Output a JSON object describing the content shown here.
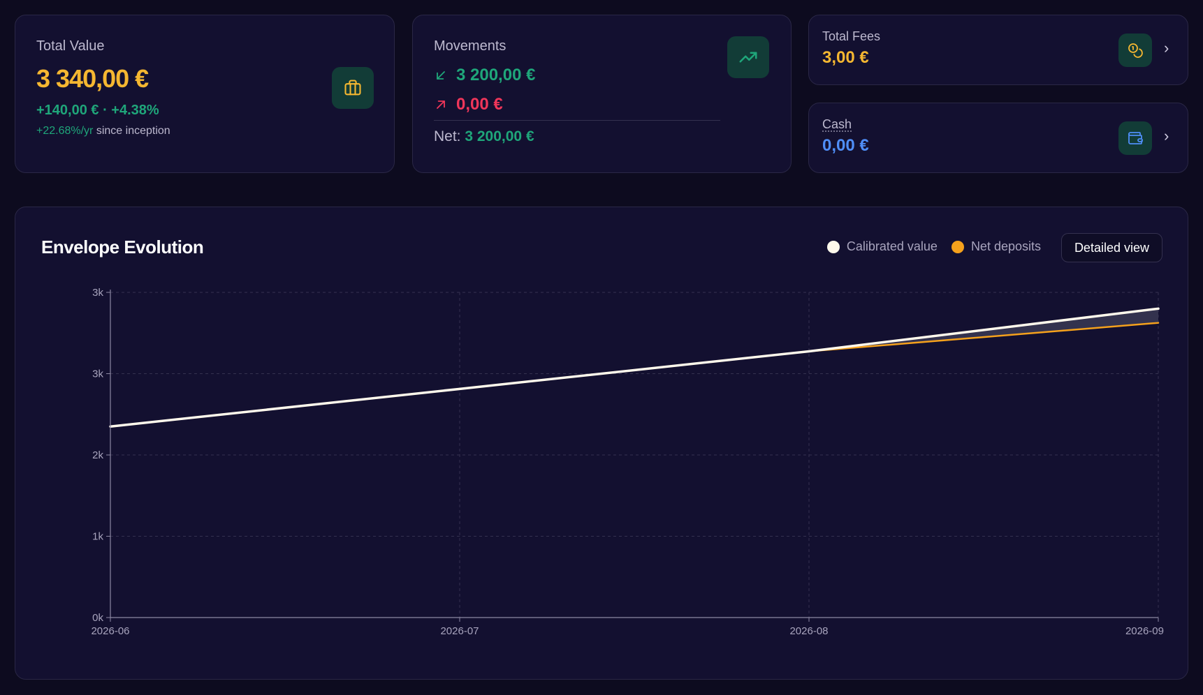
{
  "colors": {
    "gold": "#f5b731",
    "green": "#1fa67a",
    "red": "#f0365a",
    "blue": "#4f8ef7",
    "white_line": "#fff9ec",
    "orange_line": "#f5a11c"
  },
  "total_value": {
    "label": "Total Value",
    "amount": "3 340,00 €",
    "change": "+140,00 € · +4.38%",
    "annual": "+22.68%/yr",
    "since": "since inception",
    "icon": "briefcase-icon"
  },
  "movements": {
    "label": "Movements",
    "inflow": "3 200,00 €",
    "outflow": "0,00 €",
    "net_label": "Net:",
    "net_value": "3 200,00 €",
    "icon": "trending-up-icon"
  },
  "fees": {
    "label": "Total Fees",
    "amount": "3,00 €",
    "icon": "coins-icon"
  },
  "cash": {
    "label": "Cash",
    "amount": "0,00 €",
    "icon": "wallet-icon"
  },
  "chart_section": {
    "title": "Envelope Evolution",
    "detailed_button": "Detailed view"
  },
  "chart_data": {
    "type": "line",
    "title": "Envelope Evolution",
    "x": [
      "2026-06",
      "2026-07",
      "2026-08",
      "2026-09"
    ],
    "y_ticks": [
      "0k",
      "1k",
      "2k",
      "3k",
      "3k"
    ],
    "y_tick_values": [
      0,
      800,
      1600,
      2400,
      3200
    ],
    "ylim": [
      0,
      3200
    ],
    "series": [
      {
        "name": "Calibrated value",
        "color": "#fff9ec",
        "values": [
          1880,
          2250,
          2620,
          3040
        ]
      },
      {
        "name": "Net deposits",
        "color": "#f5a11c",
        "values": [
          1880,
          2250,
          2620,
          2900
        ]
      }
    ],
    "legend_position": "top-right",
    "grid": true
  }
}
